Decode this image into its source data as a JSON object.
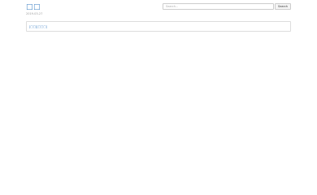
{
  "header": {
    "site_title": "□□",
    "date": "2019-03-27"
  },
  "search": {
    "placeholder": "Search...",
    "value": "",
    "button_label": "Search"
  },
  "content": {
    "text": "[□□][□□□]"
  },
  "colors": {
    "link": "#3a7fc4",
    "border": "#dddddd",
    "muted": "#9a9a9a"
  }
}
